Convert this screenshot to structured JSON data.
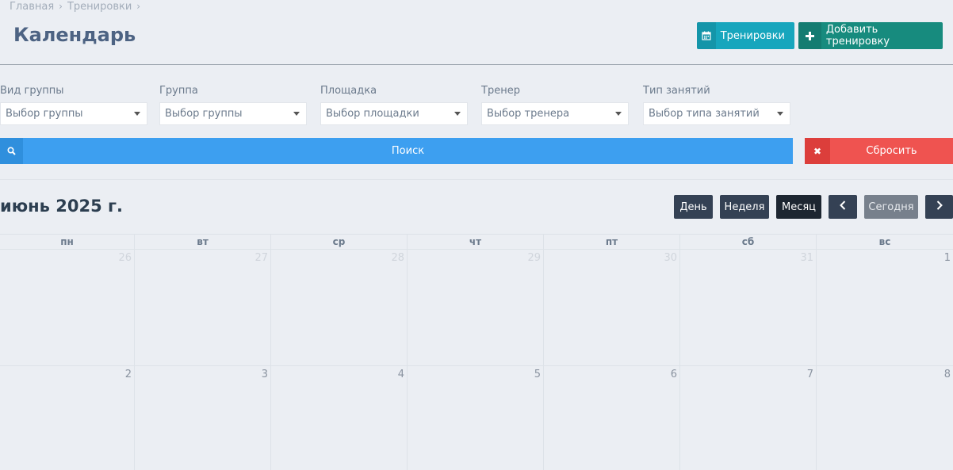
{
  "breadcrumb": [
    "Главная",
    "Тренировки"
  ],
  "page_title": "Календарь",
  "header_buttons": {
    "trainings": "Тренировки",
    "add_training": "Добавить тренировку"
  },
  "filters": [
    {
      "label": "Вид группы",
      "value": "Выбор группы"
    },
    {
      "label": "Группа",
      "value": "Выбор группы"
    },
    {
      "label": "Площадка",
      "value": "Выбор площадки"
    },
    {
      "label": "Тренер",
      "value": "Выбор тренера"
    },
    {
      "label": "Тип занятий",
      "value": "Выбор типа занятий"
    }
  ],
  "search_label": "Поиск",
  "reset_label": "Сбросить",
  "calendar": {
    "title": "июнь 2025 г.",
    "view_buttons": {
      "day": "День",
      "week": "Неделя",
      "month": "Месяц"
    },
    "active_view": "month",
    "today_label": "Сегодня",
    "weekdays": [
      "пн",
      "вт",
      "ср",
      "чт",
      "пт",
      "сб",
      "вс"
    ],
    "weeks": [
      [
        "26",
        "27",
        "28",
        "29",
        "30",
        "31",
        "1"
      ],
      [
        "2",
        "3",
        "4",
        "5",
        "6",
        "7",
        "8"
      ]
    ]
  },
  "colors": {
    "accent_blue": "#3d9ff0",
    "teal": "#17a6bd",
    "green": "#178b7e",
    "danger": "#ef5350",
    "dark": "#344154"
  }
}
